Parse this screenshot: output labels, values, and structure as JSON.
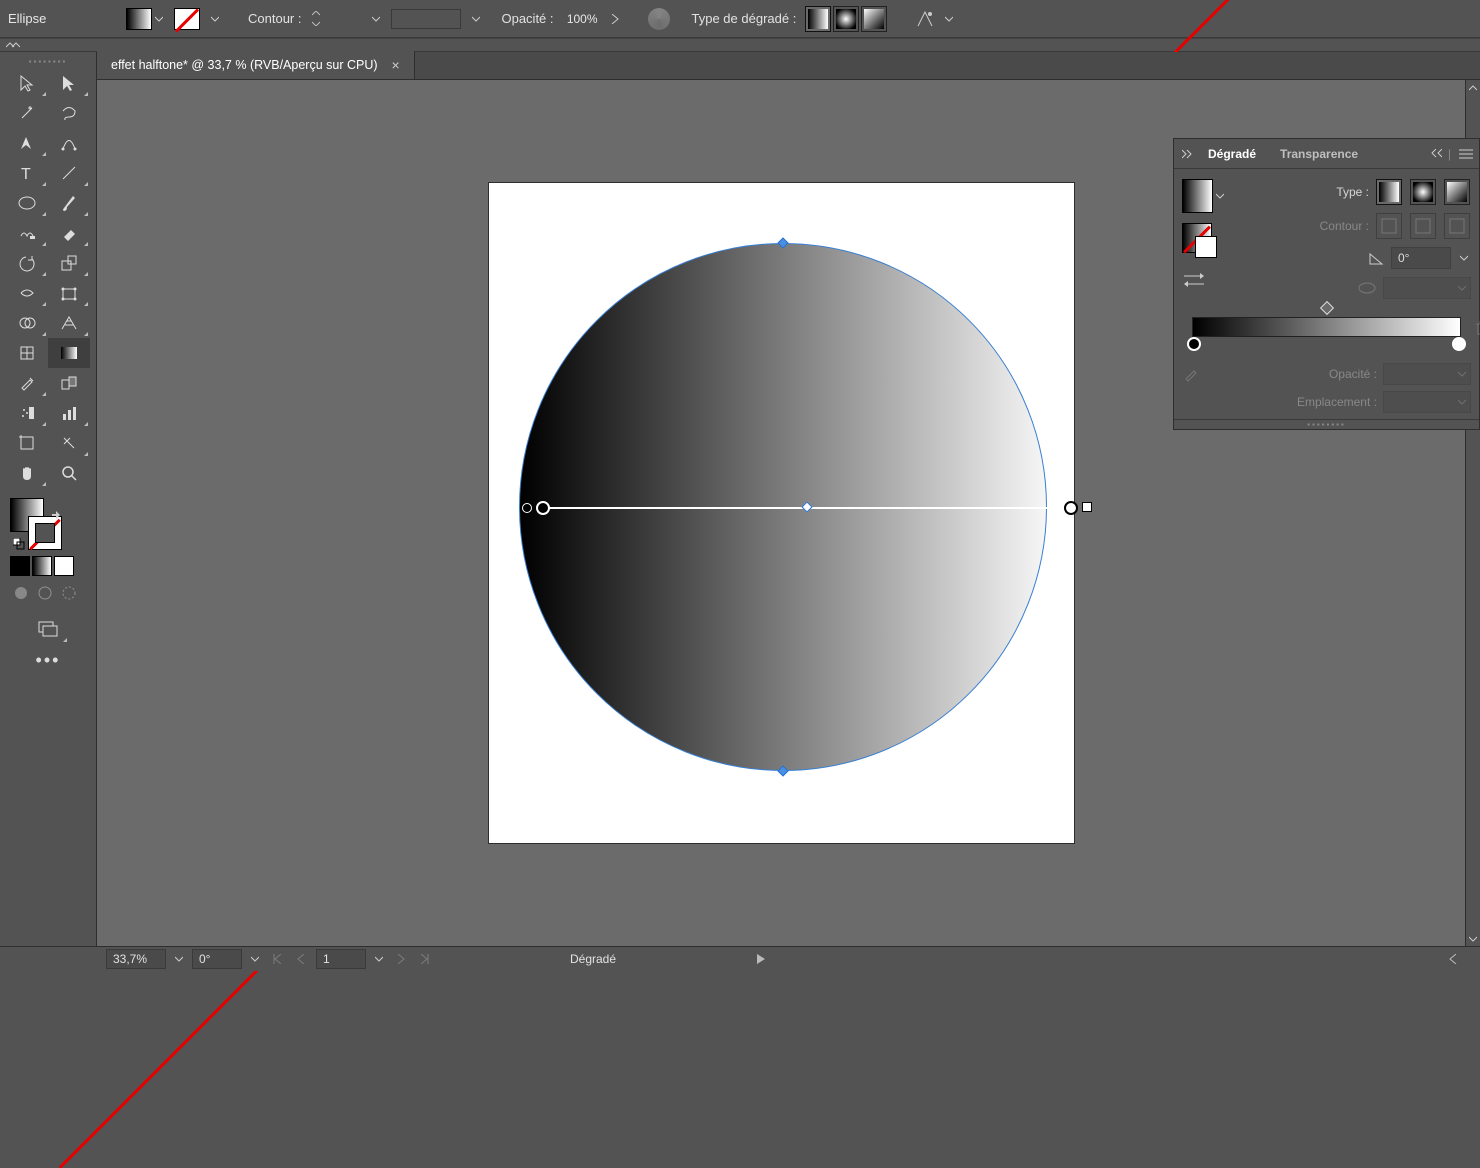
{
  "controlbar": {
    "object_label": "Ellipse",
    "stroke_label": "Contour :",
    "opacity_label": "Opacité :",
    "opacity_value": "100%",
    "gradient_type_label": "Type de dégradé :"
  },
  "tab": {
    "title": "effet halftone* @ 33,7 % (RVB/Aperçu sur CPU)"
  },
  "gradient_panel": {
    "tab_active": "Dégradé",
    "tab_other": "Transparence",
    "type_label": "Type :",
    "stroke_label": "Contour :",
    "angle_value": "0°",
    "opacity_label": "Opacité :",
    "location_label": "Emplacement :"
  },
  "status": {
    "zoom": "33,7%",
    "rotate": "0°",
    "page": "1",
    "tool_mode": "Dégradé"
  }
}
